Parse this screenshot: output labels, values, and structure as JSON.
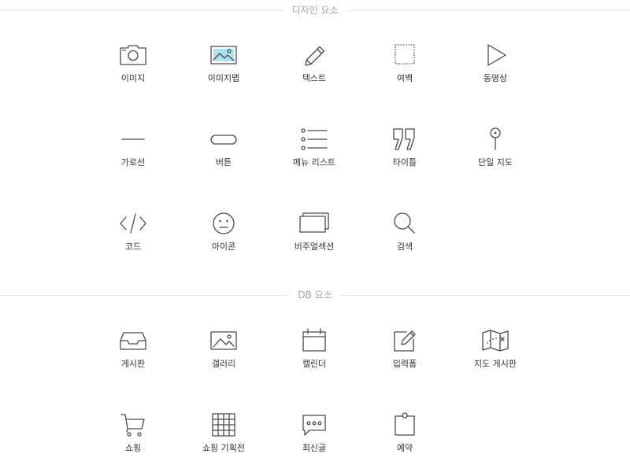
{
  "design_section": {
    "title": "디자인 요소",
    "items": [
      {
        "label": "이미지",
        "icon": "camera-icon"
      },
      {
        "label": "이미지맵",
        "icon": "image-map-icon"
      },
      {
        "label": "텍스트",
        "icon": "pencil-icon"
      },
      {
        "label": "여백",
        "icon": "dotted-square-icon"
      },
      {
        "label": "동영상",
        "icon": "play-icon"
      },
      {
        "label": "가로선",
        "icon": "horizontal-line-icon"
      },
      {
        "label": "버튼",
        "icon": "button-icon"
      },
      {
        "label": "메뉴 리스트",
        "icon": "list-icon"
      },
      {
        "label": "타이틀",
        "icon": "quote-icon"
      },
      {
        "label": "단일 지도",
        "icon": "map-pin-icon"
      },
      {
        "label": "코드",
        "icon": "code-icon"
      },
      {
        "label": "아이콘",
        "icon": "face-icon"
      },
      {
        "label": "비주얼섹션",
        "icon": "stacked-frames-icon"
      },
      {
        "label": "검색",
        "icon": "search-icon"
      }
    ]
  },
  "db_section": {
    "title": "DB 요소",
    "items": [
      {
        "label": "게시판",
        "icon": "inbox-tray-icon"
      },
      {
        "label": "갤러리",
        "icon": "gallery-icon"
      },
      {
        "label": "캘린더",
        "icon": "calendar-icon"
      },
      {
        "label": "입력폼",
        "icon": "edit-form-icon"
      },
      {
        "label": "지도 게시판",
        "icon": "folded-map-icon"
      },
      {
        "label": "쇼핑",
        "icon": "cart-icon"
      },
      {
        "label": "쇼핑 기획전",
        "icon": "grid-icon"
      },
      {
        "label": "최신글",
        "icon": "chat-bubble-icon"
      },
      {
        "label": "예약",
        "icon": "clipboard-icon"
      }
    ]
  },
  "colors": {
    "icon_stroke": "#4a4a4a",
    "icon_accent": "#6ccbea",
    "label": "#333333",
    "section_title": "#a6a6a6",
    "rule": "#e6e6e6"
  }
}
